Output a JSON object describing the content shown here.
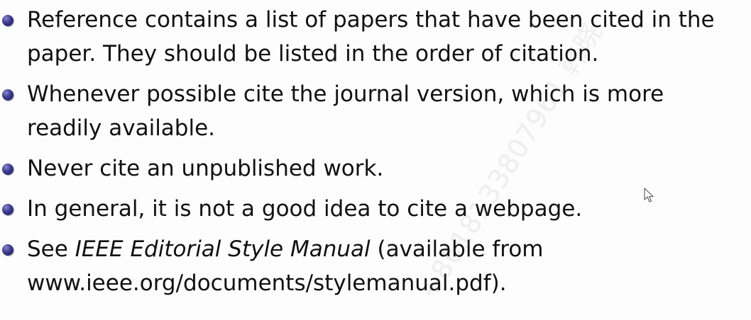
{
  "slide": {
    "bullets": [
      {
        "text": "Reference contains a list of papers that have been cited in the paper. They should be listed in the order of citation."
      },
      {
        "text": "Whenever possible cite the journal version, which is more readily available."
      },
      {
        "text": "Never cite an unpublished work."
      },
      {
        "text": "In general, it is not a good idea to cite a webpage."
      },
      {
        "prefix": "See ",
        "italic": "IEEE Editorial Style Manual",
        "suffix": " (available from www.ieee.org/documents/stylemanual.pdf)."
      }
    ],
    "watermark": "+8618133807961 韩晓"
  },
  "icons": {
    "bullet": "ball-bullet-icon",
    "cursor": "mouse-pointer-icon"
  },
  "colors": {
    "bullet": "#3b3a8e",
    "text": "#111111",
    "background": "#fdfdfd"
  }
}
